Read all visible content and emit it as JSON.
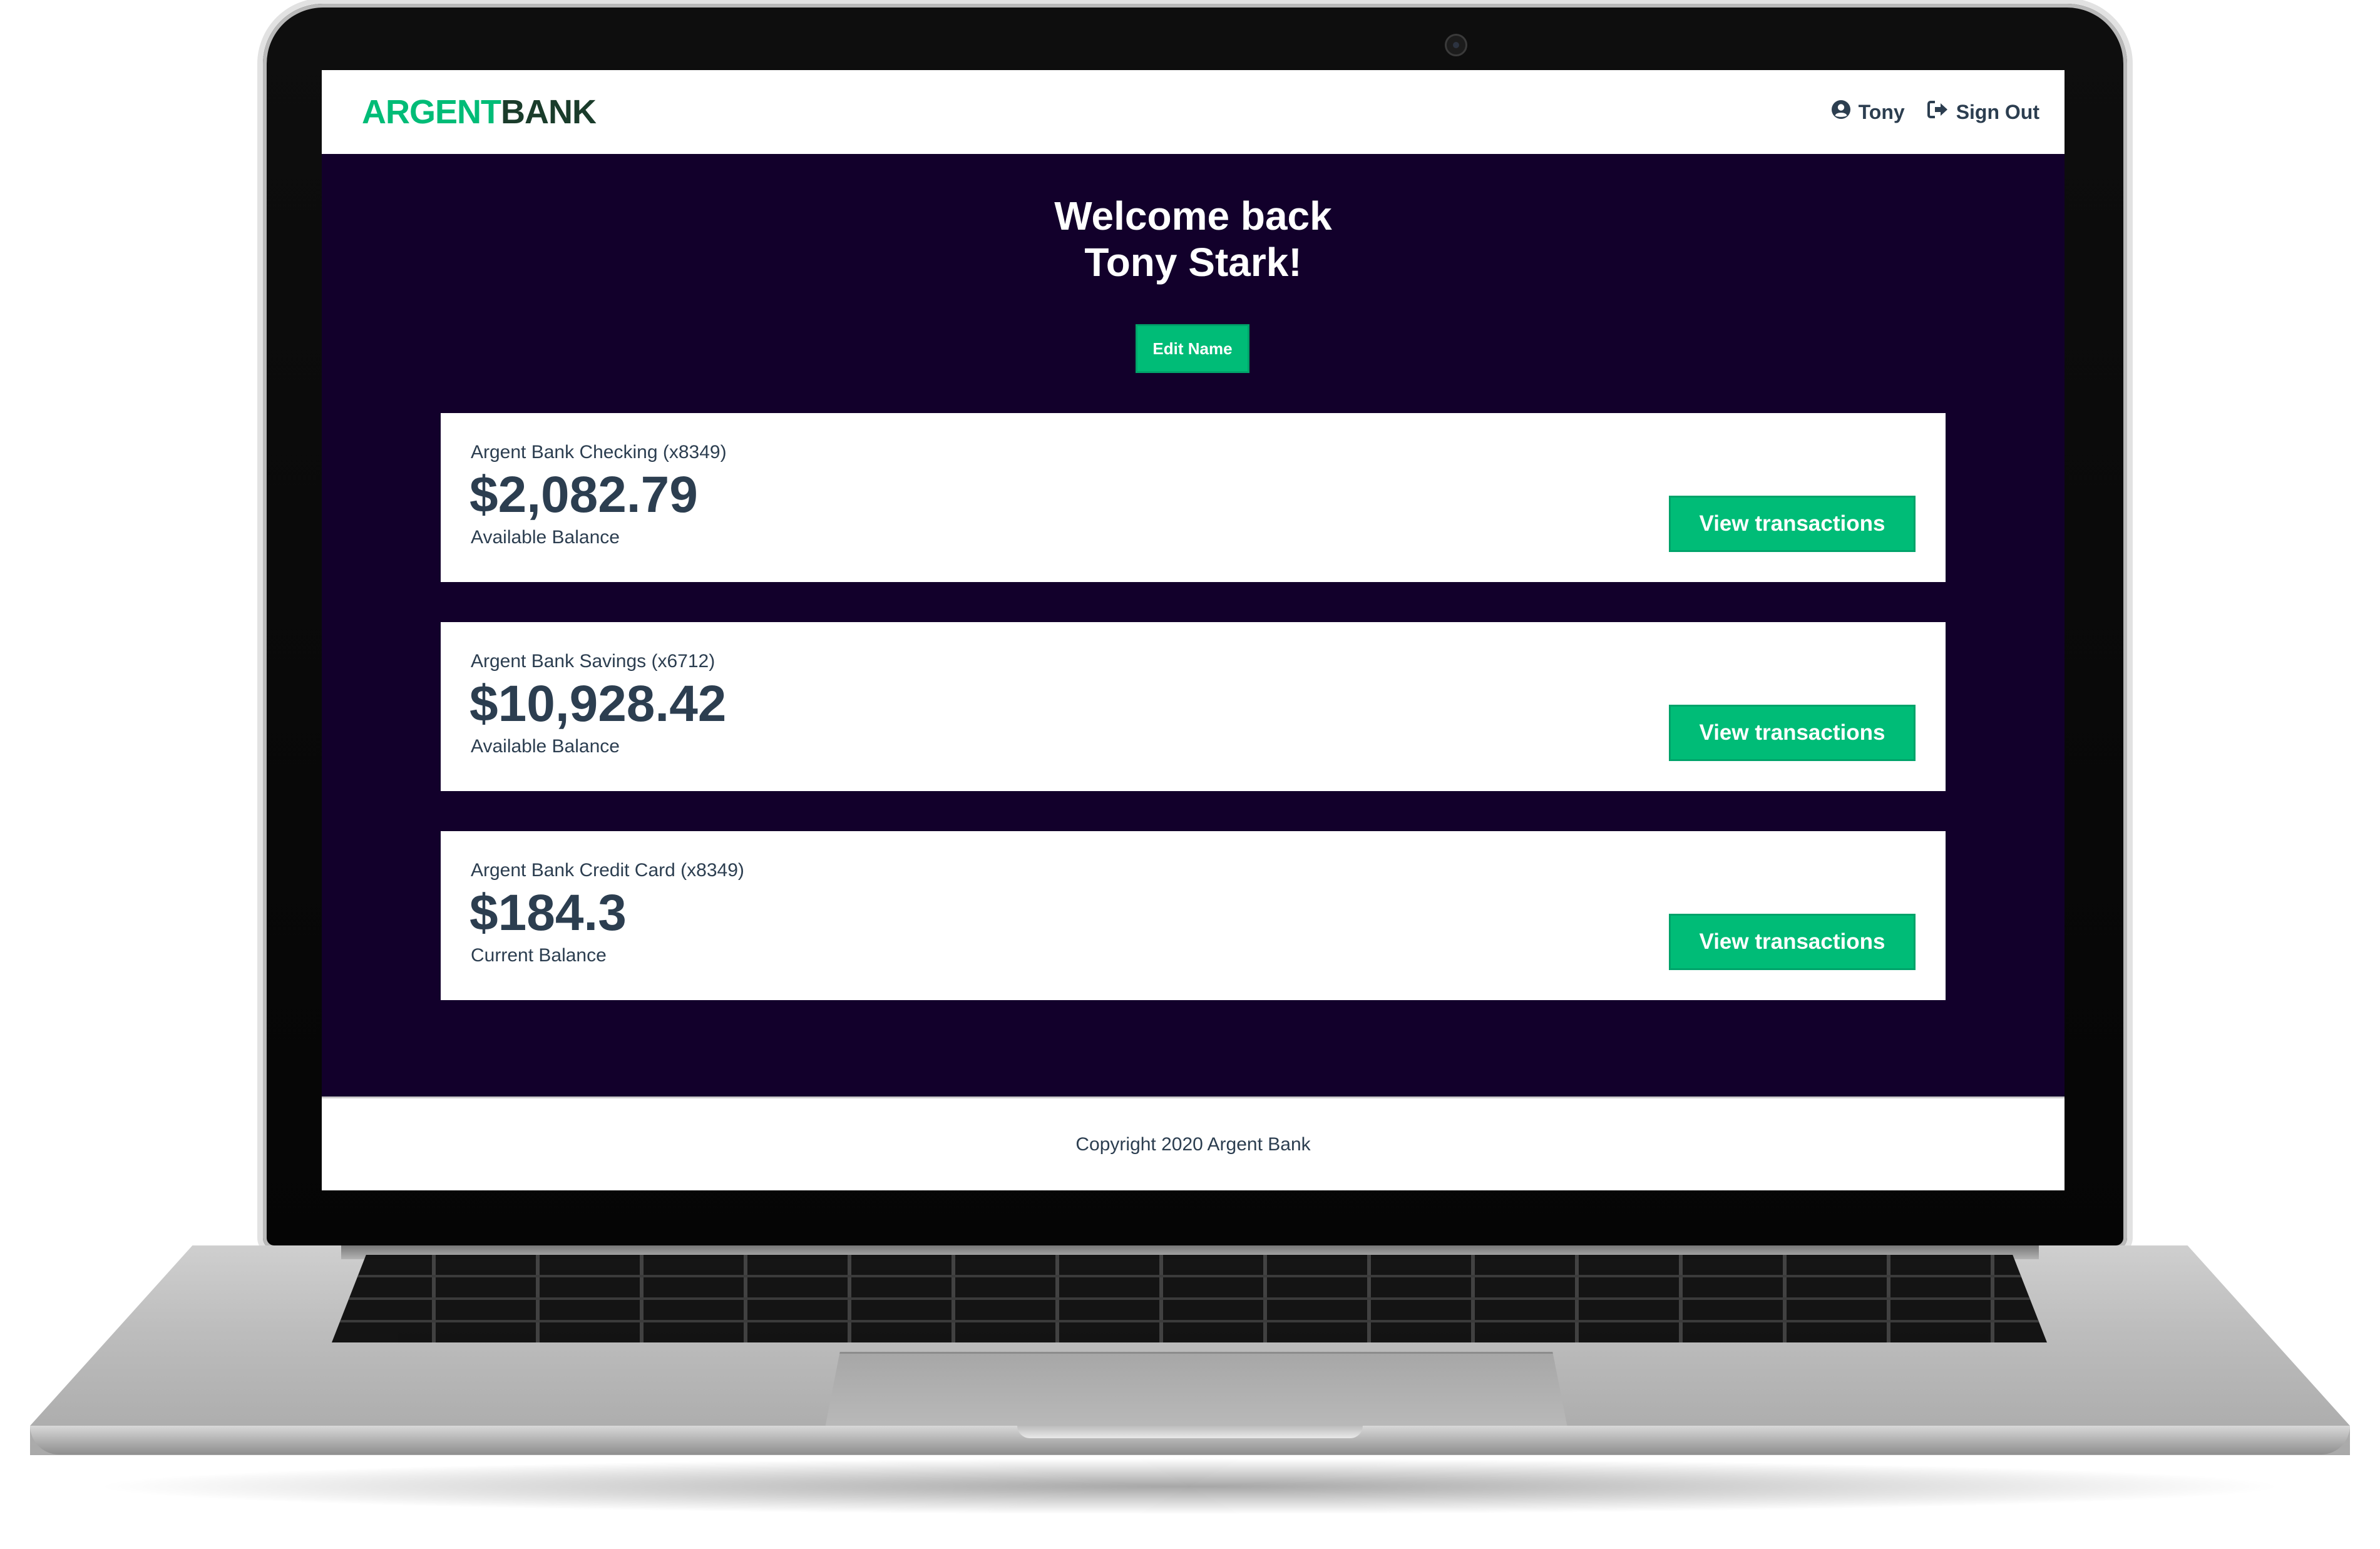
{
  "nav": {
    "logo_part1": "ARGENT",
    "logo_part2": "BANK",
    "user_label": "Tony",
    "user_icon": "user-circle-icon",
    "signout_label": "Sign Out",
    "signout_icon": "sign-out-icon"
  },
  "header": {
    "welcome_line1": "Welcome back",
    "welcome_line2": "Tony Stark!",
    "edit_button": "Edit Name"
  },
  "accounts": [
    {
      "title": "Argent Bank Checking (x8349)",
      "amount": "$2,082.79",
      "description": "Available Balance",
      "button": "View transactions"
    },
    {
      "title": "Argent Bank Savings (x6712)",
      "amount": "$10,928.42",
      "description": "Available Balance",
      "button": "View transactions"
    },
    {
      "title": "Argent Bank Credit Card (x8349)",
      "amount": "$184.3",
      "description": "Current Balance",
      "button": "View transactions"
    }
  ],
  "footer": {
    "copyright": "Copyright 2020 Argent Bank"
  },
  "colors": {
    "accent": "#00bc77",
    "logo_dark": "#1a3c2b",
    "main_background": "#12002b",
    "text_dark": "#2c3e50"
  }
}
